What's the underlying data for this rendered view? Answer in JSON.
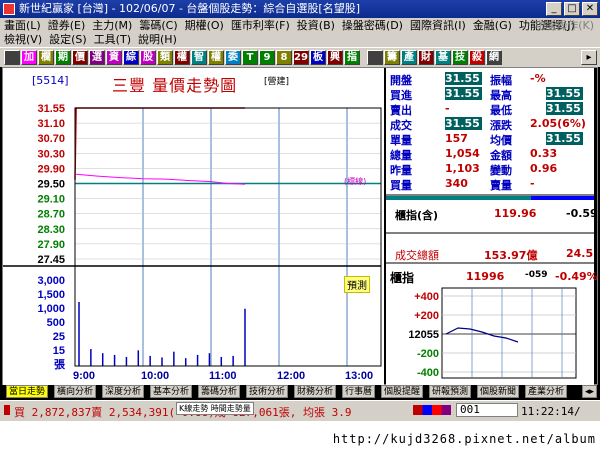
{
  "window": {
    "title": "新世紀贏家 [台灣] - 102/06/07 - 台盤個股走勢：綜合自選股[名望股]"
  },
  "menu": {
    "row1": [
      "畫面(L)",
      "證券(E)",
      "主力(M)",
      "籌碼(C)",
      "期權(O)",
      "匯市利率(F)",
      "投資(B)",
      "操盤密碼(D)",
      "國際資訊(I)",
      "金融(G)",
      "功能選擇(J)"
    ],
    "row1_right": "功能操作(K)",
    "row2": [
      "檢視(V)",
      "設定(S)",
      "工具(T)",
      "說明(H)"
    ]
  },
  "toolbar": {
    "buttons": [
      {
        "label": "",
        "color": "#404040"
      },
      {
        "label": "加",
        "color": "#ff00ff"
      },
      {
        "label": "欄",
        "color": "#808000"
      },
      {
        "label": "期",
        "color": "#008000"
      },
      {
        "label": "價",
        "color": "#800000"
      },
      {
        "label": "選",
        "color": "#800080"
      },
      {
        "label": "資",
        "color": "#c000c0"
      },
      {
        "label": "綜",
        "color": "#0000c0"
      },
      {
        "label": "股",
        "color": "#c000c0"
      },
      {
        "label": "類",
        "color": "#808000"
      },
      {
        "label": "權",
        "color": "#800000"
      },
      {
        "label": "智",
        "color": "#008080"
      },
      {
        "label": "權",
        "color": "#808000"
      },
      {
        "label": "委",
        "color": "#0080c0"
      },
      {
        "label": "T",
        "color": "#008000"
      },
      {
        "label": "9",
        "color": "#008000"
      },
      {
        "label": "8",
        "color": "#808000"
      },
      {
        "label": "29",
        "color": "#800000"
      },
      {
        "label": "板",
        "color": "#0000c0"
      },
      {
        "label": "興",
        "color": "#800000"
      },
      {
        "label": "指",
        "color": "#008000"
      },
      {
        "label": "",
        "color": "#404040"
      },
      {
        "label": "籌",
        "color": "#808000"
      },
      {
        "label": "產",
        "color": "#008080"
      },
      {
        "label": "財",
        "color": "#800000"
      },
      {
        "label": "基",
        "color": "#008080"
      },
      {
        "label": "技",
        "color": "#008000"
      },
      {
        "label": "殺",
        "color": "#c00000"
      },
      {
        "label": "網",
        "color": "#404040"
      }
    ]
  },
  "chart_header": {
    "code": "[5514]",
    "title": "三豐 量價走勢圖",
    "tag": "[營建]"
  },
  "chart_data": {
    "type": "line",
    "title": "三豐 量價走勢圖",
    "price_axis": {
      "labels": [
        "31.55",
        "31.10",
        "30.70",
        "30.30",
        "29.90",
        "29.50",
        "29.10",
        "28.70",
        "28.30",
        "27.90",
        "27.45"
      ],
      "colors": [
        "#c00000",
        "#c00000",
        "#c00000",
        "#c00000",
        "#c00000",
        "#000000",
        "#008000",
        "#008000",
        "#008000",
        "#008000",
        "#000000"
      ],
      "min": 27.45,
      "max": 31.55,
      "reference": 29.5
    },
    "volume_axis": {
      "labels": [
        "3,000",
        "1,500",
        "1,000",
        "500",
        "25",
        "15",
        "張"
      ]
    },
    "x_ticks": [
      "9:00",
      "10:00",
      "11:00",
      "12:00",
      "13:00"
    ],
    "price_series": {
      "name": "成交",
      "color": "#c00000",
      "x": [
        "09:00",
        "09:01",
        "11:30"
      ],
      "y": [
        29.6,
        31.55,
        31.55
      ]
    },
    "avg_series": {
      "name": "均價",
      "color": "#ff00ff",
      "x": [
        "09:01",
        "09:20",
        "09:40",
        "10:00",
        "10:20",
        "10:40",
        "11:00",
        "11:15",
        "11:30"
      ],
      "y": [
        29.75,
        29.7,
        29.66,
        29.63,
        29.62,
        29.58,
        29.55,
        29.5,
        29.48
      ]
    },
    "volume_hint": [
      1000,
      70,
      40,
      30,
      20,
      60,
      25,
      18,
      50,
      15,
      30,
      40,
      20,
      25,
      800
    ]
  },
  "ref_label": "(標線)",
  "predict_label": "預測",
  "quote": {
    "rows": [
      {
        "l1": "開盤",
        "v1": "31.55",
        "box1": true,
        "l2": "振幅",
        "v2": "-%",
        "box2": false
      },
      {
        "l1": "買進",
        "v1": "31.55",
        "box1": true,
        "l2": "最高",
        "v2": "31.55",
        "box2": true
      },
      {
        "l1": "賣出",
        "v1": "-",
        "box1": false,
        "l2": "最低",
        "v2": "31.55",
        "box2": true
      },
      {
        "l1": "成交",
        "v1": "31.55",
        "box1": true,
        "l2": "漲跌",
        "v2": "2.05(6%)",
        "box2": false
      },
      {
        "l1": "單量",
        "v1": "157",
        "box1": false,
        "l2": "均價",
        "v2": "31.55",
        "box2": true
      },
      {
        "l1": "總量",
        "v1": "1,054",
        "box1": false,
        "l2": "金額",
        "v2": "0.33",
        "box2": false
      },
      {
        "l1": "昨量",
        "v1": "1,103",
        "box1": false,
        "l2": "變動",
        "v2": "0.96",
        "box2": false
      },
      {
        "l1": "買量",
        "v1": "340",
        "box1": false,
        "l2": "賣量",
        "v2": "-",
        "box2": false
      }
    ]
  },
  "index": {
    "label": "櫃指(含)",
    "value": "119.96",
    "change": "-0.59",
    "turnover_label": "成交總額",
    "turnover_value": "153.97億",
    "turnover_extra": "24.5"
  },
  "mini_chart": {
    "label": "櫃指",
    "value": "11996",
    "change": "-059",
    "pct": "-0.49%",
    "ylabels": [
      "+400",
      "+200",
      "12055",
      "-200",
      "-400"
    ],
    "series": [
      0,
      30,
      25,
      10,
      -10,
      -20,
      -40
    ]
  },
  "tabs": [
    "當日走勢",
    "橫向分析",
    "深度分析",
    "基本分析",
    "籌碼分析",
    "技術分析",
    "財務分析",
    "行事曆",
    "個股提醒",
    "研報預測",
    "個股新聞",
    "產業分析"
  ],
  "status": {
    "ticker": "買 2,872,837賣 2,534,391(  0.88)成 827,061張, 均張 3.9",
    "overlay": "K線走勢 時間走勢量",
    "code": "001",
    "time": "11:22:14/"
  },
  "watermark": "http://kujd3268.pixnet.net/album"
}
